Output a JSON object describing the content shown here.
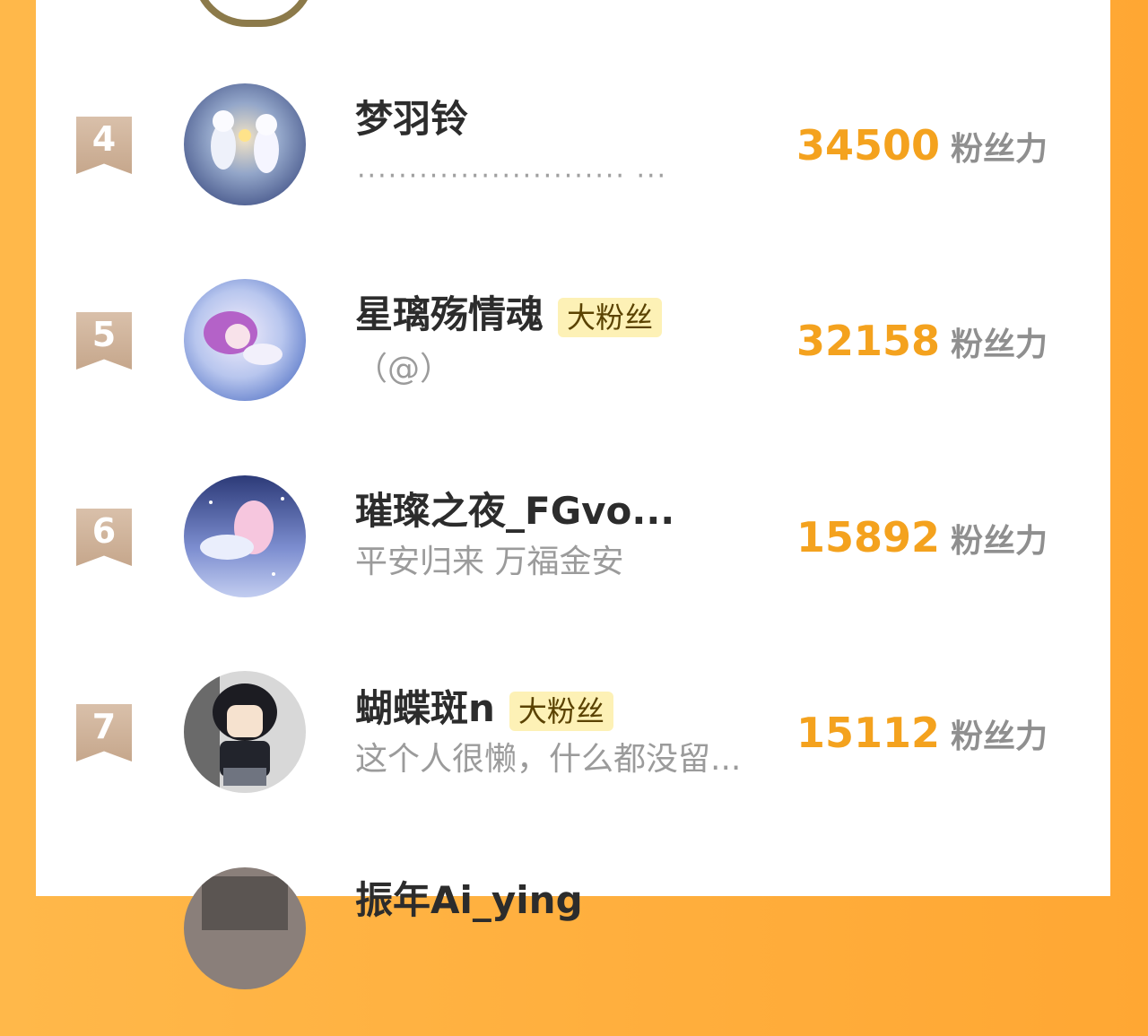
{
  "rows": [
    {
      "rank": "4",
      "name": "梦羽铃",
      "badge": "",
      "signature": "",
      "dots": "·························· ···",
      "score": "34500",
      "unit": "粉丝力"
    },
    {
      "rank": "5",
      "name": "星璃殇情魂",
      "badge": "大粉丝",
      "signature": "（@）",
      "score": "32158",
      "unit": "粉丝力"
    },
    {
      "rank": "6",
      "name": "璀璨之夜_FGvo...",
      "badge": "",
      "signature": "平安归来 万福金安",
      "score": "15892",
      "unit": "粉丝力"
    },
    {
      "rank": "7",
      "name": "蝴蝶斑n",
      "badge": "大粉丝",
      "signature": "这个人很懒，什么都没留...",
      "score": "15112",
      "unit": "粉丝力"
    },
    {
      "rank": "",
      "name": "振年Ai_ying",
      "badge": "",
      "signature": "",
      "score": "",
      "unit": ""
    }
  ],
  "colors": {
    "accent": "#f4a21e",
    "badge_bg": "#fdf1b6",
    "rank_tag": "#c6a78c",
    "frame": "#ffa733"
  }
}
